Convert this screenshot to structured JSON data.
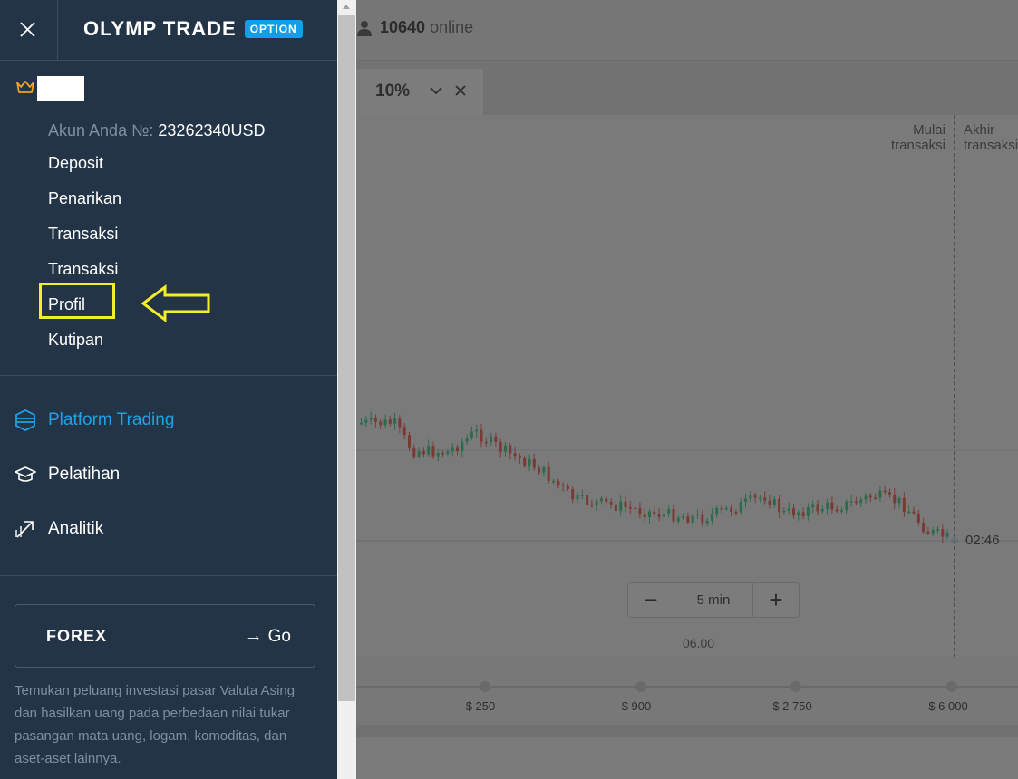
{
  "sidebar": {
    "logo_text": "OLYMP TRADE",
    "logo_badge": "OPTION",
    "account_label": "Akun Anda №:",
    "account_value": "23262340USD",
    "menu_items": [
      {
        "label": "Deposit"
      },
      {
        "label": "Penarikan"
      },
      {
        "label": "Transaksi"
      },
      {
        "label": "Transaksi"
      },
      {
        "label": "Profil"
      },
      {
        "label": "Kutipan"
      }
    ],
    "nav_items": [
      {
        "label": "Platform Trading",
        "icon": "platform-icon",
        "active": true
      },
      {
        "label": "Pelatihan",
        "icon": "graduation-cap-icon",
        "active": false
      },
      {
        "label": "Analitik",
        "icon": "analytics-arrow-icon",
        "active": false
      }
    ],
    "forex": {
      "title": "FOREX",
      "go_label": "Go",
      "description": "Temukan peluang investasi pasar Valuta Asing dan hasilkan uang pada perbedaan nilai tukar pasangan mata uang, logam, komoditas, dan aset-aset lainnya."
    }
  },
  "header": {
    "online_count": "10640",
    "online_label": "online"
  },
  "tab": {
    "percent": "10%"
  },
  "chart": {
    "start_label": "Mulai transaksi",
    "end_label": "Akhir transaksi",
    "time": "02:46",
    "date_tick": "06.00",
    "interval_minus": "−",
    "interval": "5 min",
    "interval_plus": "+"
  },
  "slider": {
    "labels": [
      "$ 250",
      "$ 900",
      "$ 2 750",
      "$ 6 000"
    ],
    "positions": [
      0.195,
      0.43,
      0.663,
      0.9
    ]
  },
  "colors": {
    "sidebar_bg": "#243447",
    "accent": "#1ea2e8",
    "highlight": "#f3ee2c",
    "crown": "#f0a51e"
  }
}
